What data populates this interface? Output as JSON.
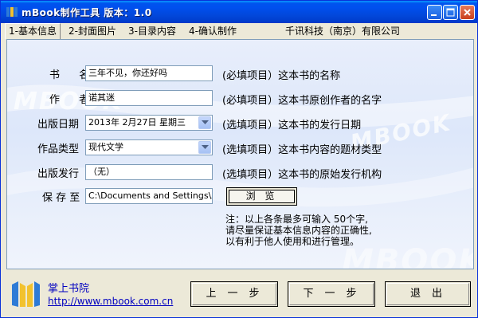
{
  "window": {
    "title": "mBook制作工具  版本：1.0",
    "app_icon": "mbook-logo-icon",
    "controls": [
      "minimize-icon",
      "maximize-icon",
      "close-icon"
    ]
  },
  "tabs": [
    {
      "label": "1-基本信息",
      "active": true
    },
    {
      "label": "2-封面图片",
      "active": false
    },
    {
      "label": "3-目录内容",
      "active": false
    },
    {
      "label": "4-确认制作",
      "active": false
    }
  ],
  "company": "千讯科技（南京）有限公司",
  "form": {
    "title": {
      "label": "书  名",
      "value": "三年不见，你还好吗",
      "hint": "(必填项目）这本书的名称"
    },
    "author": {
      "label": "作  者",
      "value": "诺其迷",
      "hint": "(必填项目）这本书原创作者的名字"
    },
    "date": {
      "label": "出版日期",
      "value": "2013年  2月27日 星期三",
      "hint": "(选填项目）这本书的发行日期"
    },
    "genre": {
      "label": "作品类型",
      "value": "现代文学",
      "hint": "(选填项目）这本书内容的题材类型"
    },
    "publisher": {
      "label": "出版发行",
      "value": "（无）",
      "hint": "(选填项目）这本书的原始发行机构"
    },
    "save": {
      "label": "保 存 至",
      "value": "C:\\Documents and Settings\\Admir",
      "browse": "浏 览"
    }
  },
  "note": [
    "注：以上各条最多可输入 50个字,",
    "请尽量保证基本信息内容的正确性,",
    "以有利于他人使用和进行管理。"
  ],
  "watermark": {
    "text": "MBOOK"
  },
  "footer": {
    "site_name": "掌上书院",
    "site_url": "http://www.mbook.com.cn",
    "prev": "上一步",
    "next": "下一步",
    "exit": "退出"
  },
  "colors": {
    "titlebar": "#0053ee",
    "link": "#0000c0",
    "panel": "#dde7fa"
  }
}
